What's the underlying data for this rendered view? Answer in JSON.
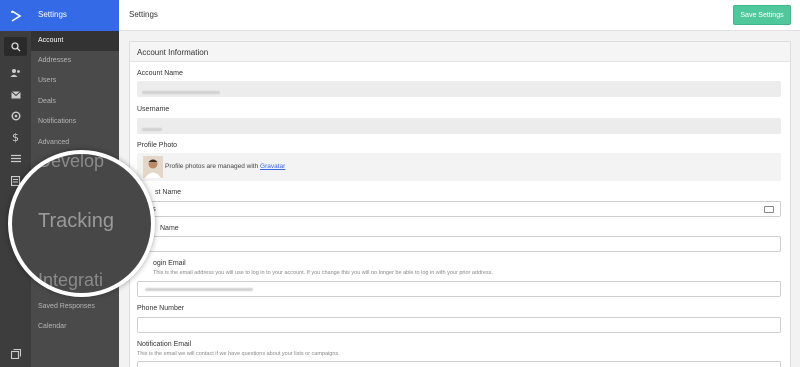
{
  "header": {
    "subnav_title": "Settings",
    "page_title": "Settings",
    "save_label": "Save Settings"
  },
  "rail": {
    "icons": [
      "logo-chevron-icon",
      "search-icon",
      "contacts-icon",
      "mail-icon",
      "automation-icon",
      "dollar-icon",
      "list-icon",
      "forms-icon",
      "copy-icon"
    ]
  },
  "subnav": {
    "items": [
      {
        "label": "Account"
      },
      {
        "label": "Addresses"
      },
      {
        "label": "Users"
      },
      {
        "label": "Deals"
      },
      {
        "label": "Notifications"
      },
      {
        "label": "Advanced"
      },
      {
        "label": "Saved Responses"
      },
      {
        "label": "Calendar"
      }
    ],
    "sections": {
      "developer": "Develop",
      "tracking": "Tracking",
      "integrations": "Integrati"
    }
  },
  "card": {
    "title": "Account Information",
    "fields": {
      "account_name_label": "Account Name",
      "username_label": "Username",
      "profile_photo_label": "Profile Photo",
      "profile_photo_text": "Profile photos are managed with ",
      "gravatar_link": "Gravatar",
      "first_name_label": "st Name",
      "first_name_value": "n's",
      "last_name_label": "Name",
      "last_name_value": "v",
      "login_email_label": "ogin Email",
      "login_email_help": "This is the email address you will use to log in to your account. If you change this you will no longer be able to log in with your prior address.",
      "phone_label": "Phone Number",
      "notification_email_label": "Notification Email",
      "notification_email_help": "This is the email we will contact if we have questions about your lists or campaigns."
    }
  },
  "colors": {
    "brand_blue": "#356ae6",
    "save_green": "#4fc89c",
    "sidebar_dark": "#3d3d3d"
  }
}
